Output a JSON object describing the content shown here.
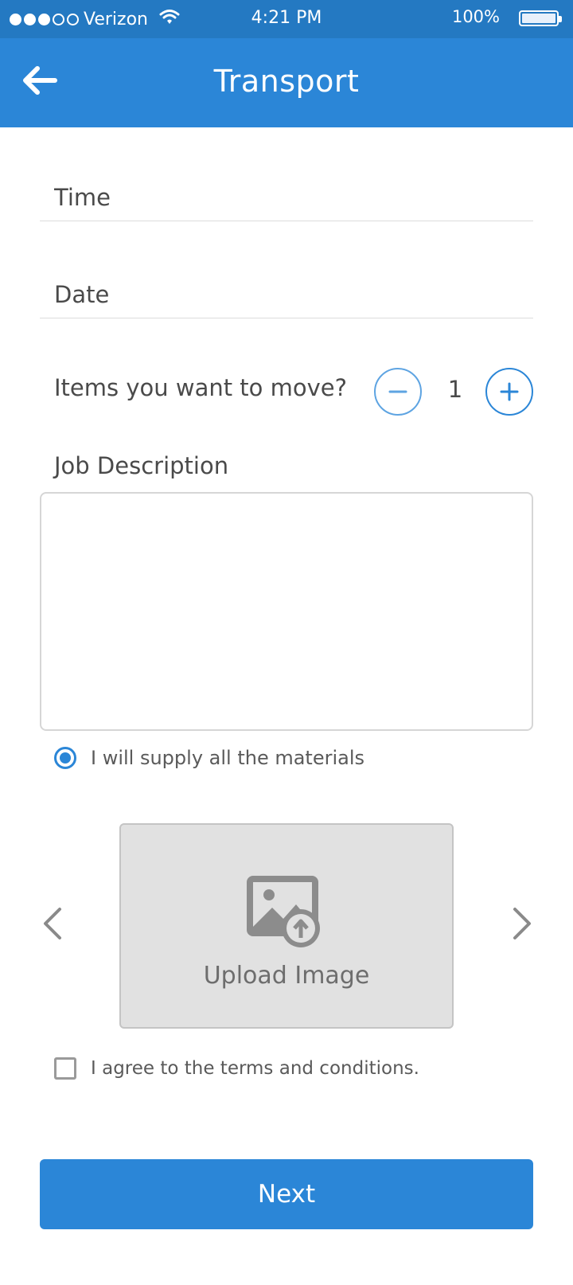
{
  "status_bar": {
    "carrier": "Verizon",
    "signal_bars_filled": 3,
    "signal_bars_total": 5,
    "time": "4:21 PM",
    "battery": "100%"
  },
  "app_bar": {
    "title": "Transport",
    "back_icon": "arrow-left-icon"
  },
  "form": {
    "time_placeholder": "Time",
    "date_placeholder": "Date",
    "items": {
      "label": "Items you want to move?",
      "count": "1"
    },
    "job_description_label": "Job Description",
    "job_description_value": "",
    "materials": {
      "label": "I will supply all the materials",
      "selected": true
    },
    "upload": {
      "label": "Upload Image",
      "icon": "image-upload-icon"
    },
    "terms": {
      "label": "I agree to the terms and conditions.",
      "checked": false
    },
    "next_label": "Next"
  },
  "colors": {
    "status_bar": "#2479c2",
    "app_bar": "#2b86d7",
    "accent": "#2b86d7",
    "upload_bg": "#e1e1e1"
  }
}
